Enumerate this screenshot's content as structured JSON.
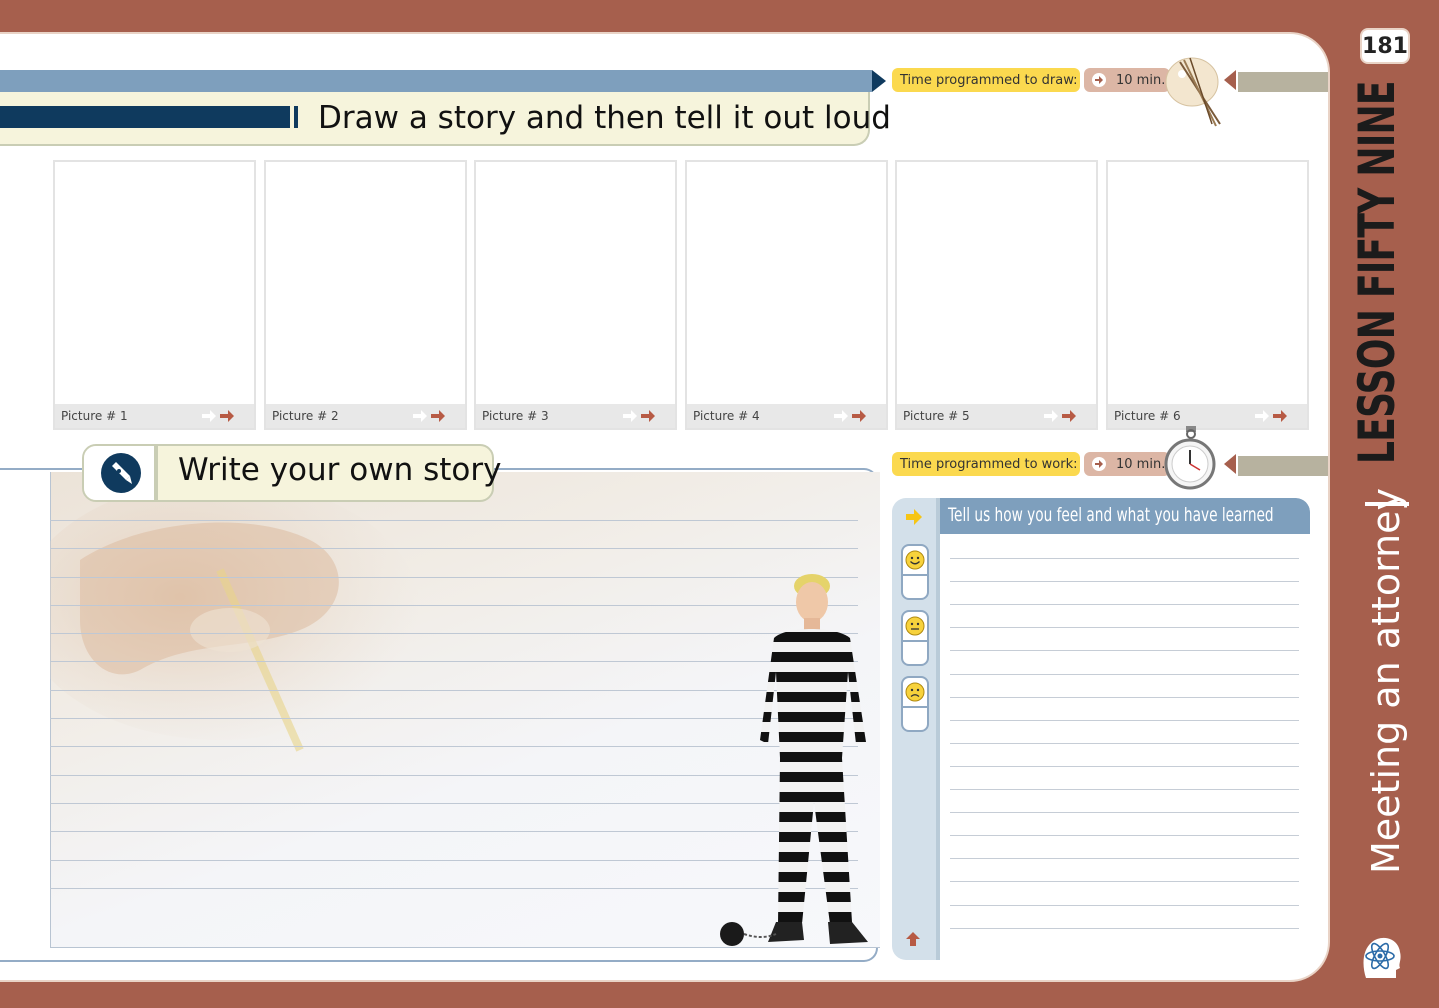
{
  "page_number": "181",
  "lesson": {
    "title": "LESSON FIFTY NINE",
    "subtitle": "Meeting an attorney"
  },
  "draw_section": {
    "title": "Draw a story and then tell it out loud",
    "time_label": "Time programmed to draw:",
    "time_value": "10 min.",
    "pictures": [
      {
        "label": "Picture # 1"
      },
      {
        "label": "Picture # 2"
      },
      {
        "label": "Picture # 3"
      },
      {
        "label": "Picture # 4"
      },
      {
        "label": "Picture # 5"
      },
      {
        "label": "Picture # 6"
      }
    ]
  },
  "write_section": {
    "title": "Write your own story",
    "time_label": "Time programmed to work:",
    "time_value": "10 min."
  },
  "feel_section": {
    "title": "Tell us how you feel and what you have learned",
    "emojis": [
      "happy-face-icon",
      "neutral-face-icon",
      "sad-face-icon"
    ]
  },
  "colors": {
    "brand_brown": "#a65f4d",
    "navy": "#0f3a5e",
    "steel_blue": "#7e9fbd",
    "chip_yellow": "#fbd94f",
    "chip_tan": "#dcb6a5"
  }
}
